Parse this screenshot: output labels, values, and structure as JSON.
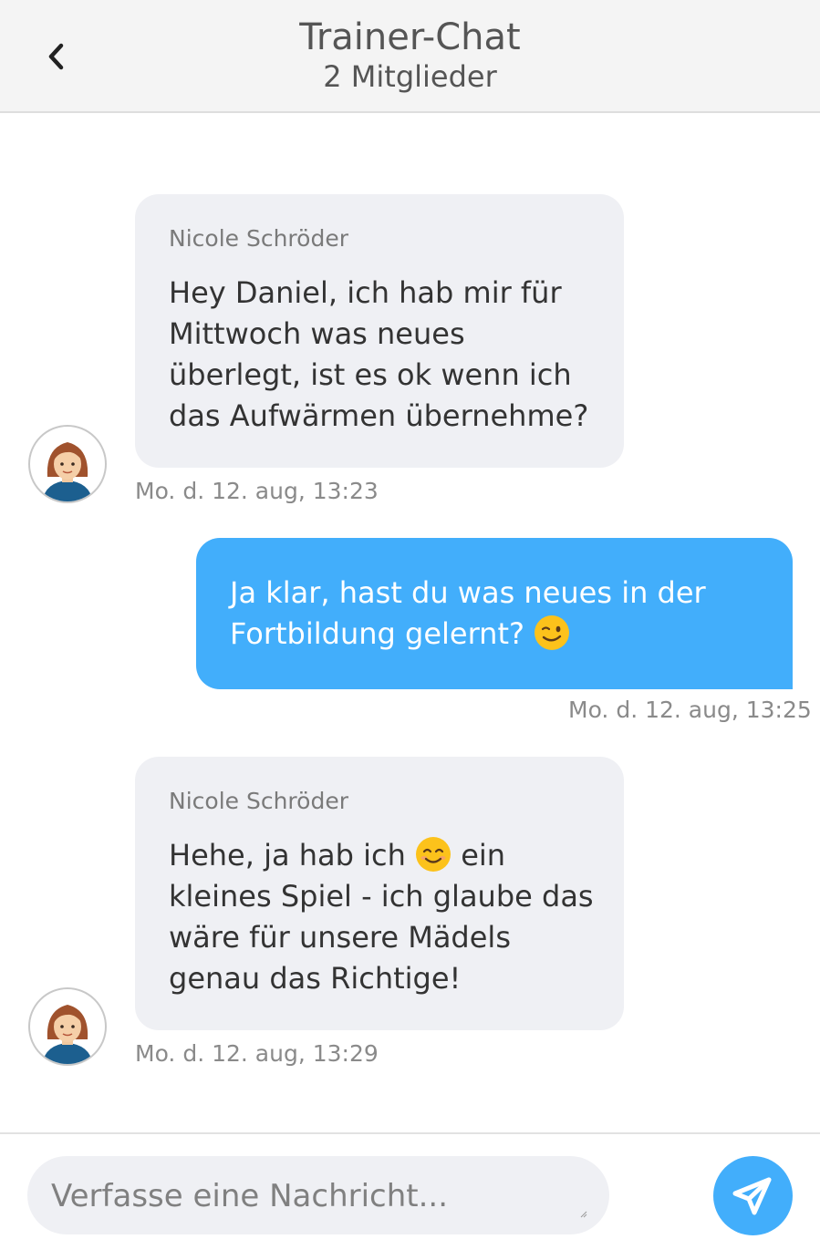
{
  "header": {
    "title": "Trainer-Chat",
    "subtitle": "2 Mitglieder",
    "back_icon": "chevron-left-icon"
  },
  "messages": [
    {
      "direction": "incoming",
      "sender": "Nicole Schröder",
      "text": "Hey Daniel, ich hab mir für Mittwoch was neues überlegt, ist es ok wenn ich das Aufwärmen übernehme?",
      "time": "Mo. d. 12. aug, 13:23"
    },
    {
      "direction": "outgoing",
      "text_before_emoji": "Ja klar, hast du was neues in der Fortbildung gelernt?",
      "emoji": "winking-face-emoji",
      "time": "Mo. d. 12. aug, 13:25"
    },
    {
      "direction": "incoming",
      "sender": "Nicole Schröder",
      "text_before_emoji": "Hehe, ja hab ich",
      "emoji": "smiling-face-emoji",
      "text_after_emoji": "ein kleines Spiel - ich glaube das wäre für unsere Mädels genau das Richtige!",
      "time": "Mo. d. 12. aug, 13:29"
    }
  ],
  "composer": {
    "placeholder": "Verfasse eine Nachricht...",
    "value": "",
    "send_icon": "paper-plane-icon"
  },
  "colors": {
    "accent": "#42aefb",
    "incoming_bubble": "#eff0f4",
    "header_bg": "#f4f4f4"
  }
}
